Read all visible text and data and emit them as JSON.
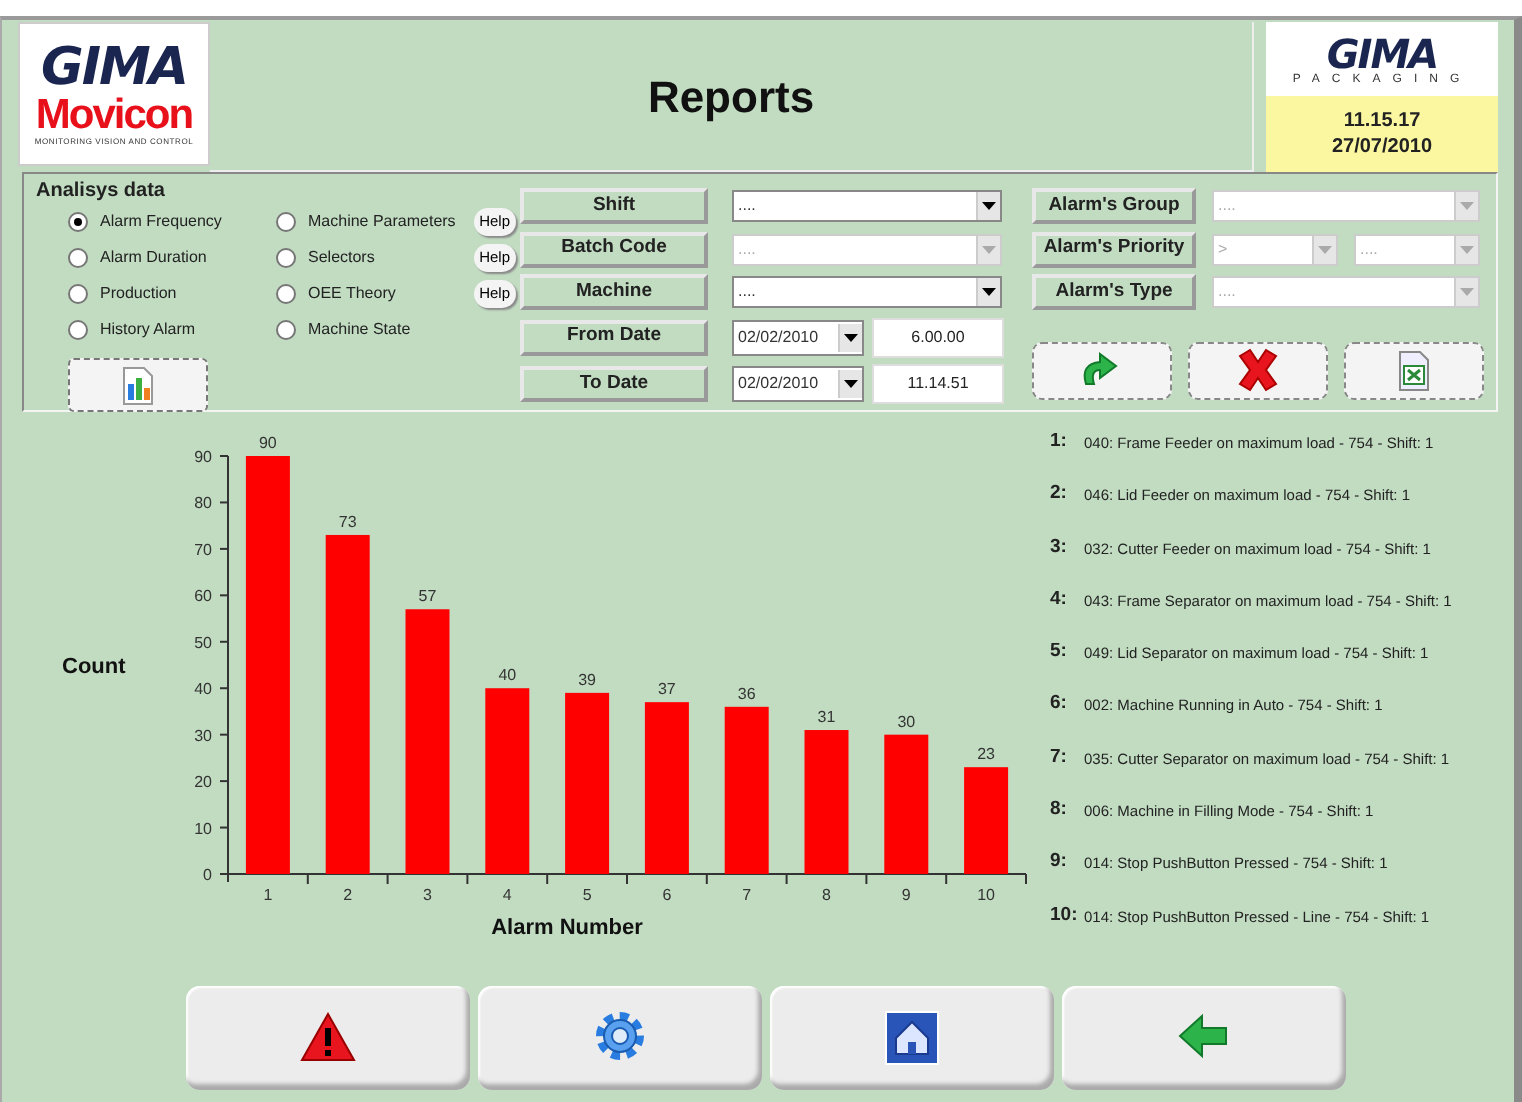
{
  "header": {
    "logo_left": {
      "brand": "GIMA",
      "product": "Movicon",
      "tagline": "MONITORING VISION AND CONTROL"
    },
    "title": "Reports",
    "logo_right": {
      "brand": "GIMA",
      "subtitle": "PACKAGING"
    },
    "time": "11.15.17",
    "date": "27/07/2010"
  },
  "analysis": {
    "title": "Analisys data",
    "options": [
      {
        "label": "Alarm Frequency",
        "selected": true
      },
      {
        "label": "Alarm Duration",
        "selected": false
      },
      {
        "label": "Production",
        "selected": false
      },
      {
        "label": "History Alarm",
        "selected": false
      },
      {
        "label": "Machine Parameters",
        "selected": false,
        "help": "Help"
      },
      {
        "label": "Selectors",
        "selected": false,
        "help": "Help"
      },
      {
        "label": "OEE Theory",
        "selected": false,
        "help": "Help"
      },
      {
        "label": "Machine State",
        "selected": false
      }
    ]
  },
  "filters": [
    {
      "kind": "combo",
      "label": "Shift",
      "value": "....",
      "disabled": false
    },
    {
      "kind": "combo",
      "label": "Batch Code",
      "value": "....",
      "disabled": true
    },
    {
      "kind": "combo",
      "label": "Machine",
      "value": "....",
      "disabled": false
    },
    {
      "kind": "date",
      "label": "From Date",
      "date": "02/02/2010",
      "time": "6.00.00"
    },
    {
      "kind": "date",
      "label": "To Date",
      "date": "02/02/2010",
      "time": "11.14.51"
    }
  ],
  "alarm_filters": [
    {
      "label": "Alarm's Group",
      "combos": [
        {
          "value": "....",
          "disabled": true
        }
      ]
    },
    {
      "label": "Alarm's Priority",
      "combos": [
        {
          "value": ">",
          "disabled": true
        },
        {
          "value": "....",
          "disabled": true
        }
      ]
    },
    {
      "label": "Alarm's Type",
      "combos": [
        {
          "value": "....",
          "disabled": true
        }
      ]
    }
  ],
  "chart": {
    "chart_data": {
      "type": "bar",
      "xlabel": "Alarm Number",
      "ylabel": "Count",
      "categories": [
        "1",
        "2",
        "3",
        "4",
        "5",
        "6",
        "7",
        "8",
        "9",
        "10"
      ],
      "series": [
        {
          "color": "#ff0000",
          "values": [
            90,
            73,
            57,
            40,
            39,
            37,
            36,
            31,
            30,
            23
          ]
        }
      ],
      "ylim": [
        0,
        90
      ],
      "yticks": [
        0,
        10,
        20,
        30,
        40,
        50,
        60,
        70,
        80,
        90
      ],
      "data_labels": true
    }
  },
  "legend": [
    {
      "number": "1:",
      "text": "040: Frame Feeder on maximum load - 754 - Shift: 1"
    },
    {
      "number": "2:",
      "text": "046: Lid Feeder on maximum load - 754 - Shift: 1"
    },
    {
      "number": "3:",
      "text": "032: Cutter Feeder on maximum load - 754 - Shift: 1"
    },
    {
      "number": "4:",
      "text": "043: Frame Separator on maximum load - 754 - Shift: 1"
    },
    {
      "number": "5:",
      "text": "049: Lid Separator on maximum load - 754 - Shift: 1"
    },
    {
      "number": "6:",
      "text": "002: Machine Running in Auto  - 754 - Shift: 1"
    },
    {
      "number": "7:",
      "text": "035: Cutter Separator on maximum load - 754 - Shift: 1"
    },
    {
      "number": "8:",
      "text": "006: Machine in Filling Mode - 754 - Shift: 1"
    },
    {
      "number": "9:",
      "text": "014: Stop PushButton Pressed - 754 - Shift: 1"
    },
    {
      "number": "10:",
      "text": "014: Stop PushButton Pressed - Line - 754 - Shift: 1"
    }
  ]
}
